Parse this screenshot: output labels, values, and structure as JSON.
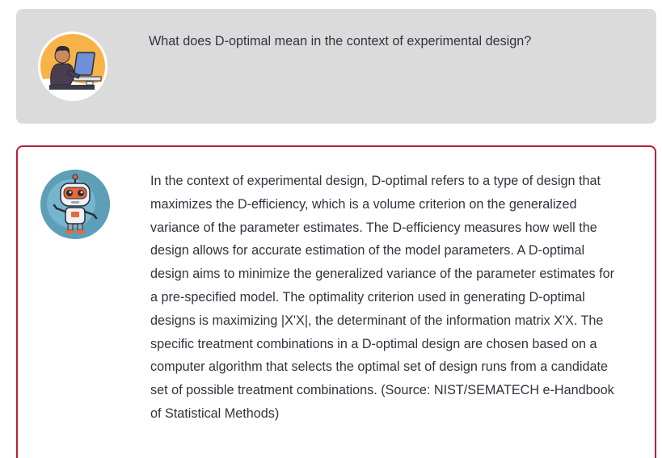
{
  "conversation": {
    "user_message": {
      "avatar_icon": "person-at-laptop-icon",
      "text": "What does D-optimal mean in the context of experimental design?"
    },
    "assistant_message": {
      "avatar_icon": "robot-icon",
      "accent_color": "#b4203a",
      "text": "In the context of experimental design, D-optimal refers to a type of design that maximizes the D-efficiency, which is a volume criterion on the generalized variance of the parameter estimates. The D-efficiency measures how well the design allows for accurate estimation of the model parameters. A D-optimal design aims to minimize the generalized variance of the parameter estimates for a pre-specified model. The optimality criterion used in generating D-optimal designs is maximizing |X'X|, the determinant of the information matrix X'X. The specific treatment combinations in a D-optimal design are chosen based on a computer algorithm that selects the optimal set of design runs from a candidate set of possible treatment combinations. (Source: NIST/SEMATECH e-Handbook of Statistical Methods)"
    }
  }
}
